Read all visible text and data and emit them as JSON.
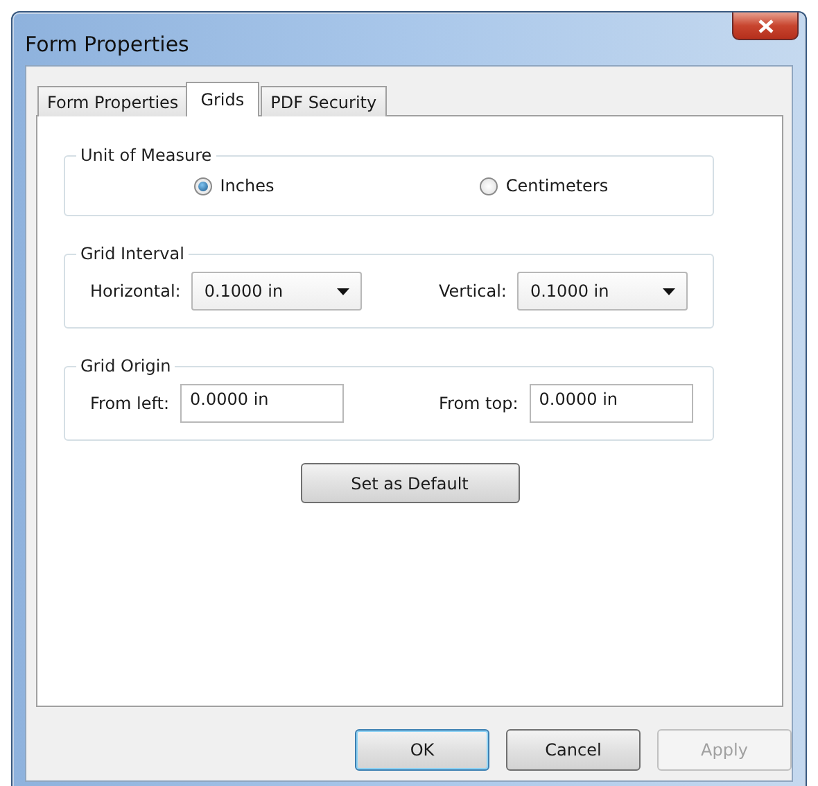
{
  "window": {
    "title": "Form Properties"
  },
  "tabs": [
    {
      "label": "Form Properties",
      "selected": false
    },
    {
      "label": "Grids",
      "selected": true
    },
    {
      "label": "PDF Security",
      "selected": false
    }
  ],
  "groups": [
    {
      "title": "Unit of Measure",
      "kind": "radio",
      "items": [
        {
          "label": "Inches",
          "selected": true
        },
        {
          "label": "Centimeters",
          "selected": false
        }
      ]
    },
    {
      "title": "Grid Interval",
      "kind": "combo",
      "items": [
        {
          "label": "Horizontal:",
          "value": "0.1000 in"
        },
        {
          "label": "Vertical:",
          "value": "0.1000 in"
        }
      ]
    },
    {
      "title": "Grid Origin",
      "kind": "text",
      "items": [
        {
          "label": "From left:",
          "value": "0.0000 in"
        },
        {
          "label": "From top:",
          "value": "0.0000 in"
        }
      ]
    }
  ],
  "set_default_button": "Set as Default",
  "buttons": [
    {
      "label": "OK",
      "default": true,
      "disabled": false
    },
    {
      "label": "Cancel",
      "default": false,
      "disabled": false
    },
    {
      "label": "Apply",
      "default": false,
      "disabled": true
    }
  ]
}
